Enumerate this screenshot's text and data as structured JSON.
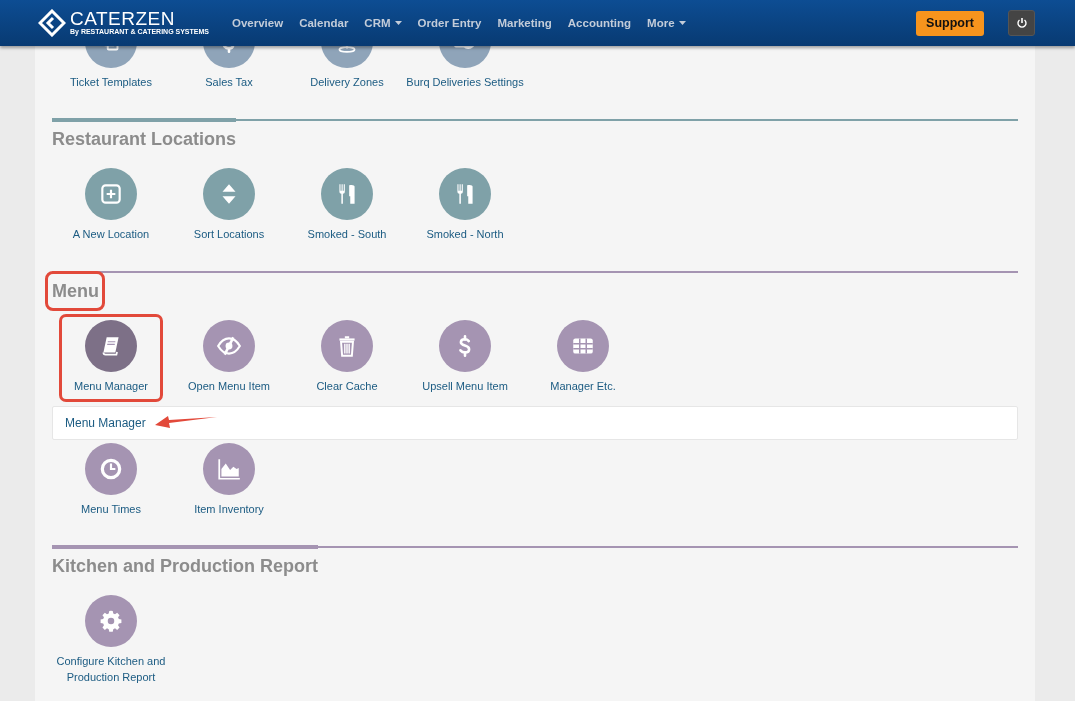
{
  "navbar": {
    "brand": "CATERZEN",
    "tagline": "By RESTAURANT & CATERING SYSTEMS",
    "items": [
      {
        "label": "Overview",
        "dropdown": false
      },
      {
        "label": "Calendar",
        "dropdown": false
      },
      {
        "label": "CRM",
        "dropdown": true
      },
      {
        "label": "Order Entry",
        "dropdown": false
      },
      {
        "label": "Marketing",
        "dropdown": false
      },
      {
        "label": "Accounting",
        "dropdown": false
      },
      {
        "label": "More",
        "dropdown": true
      }
    ],
    "support": "Support"
  },
  "sections": [
    {
      "color": "#8fa4b9",
      "rows": [
        [
          {
            "kind": "copy",
            "label": "Ticket Templates",
            "selected": false,
            "highlighted": false
          },
          {
            "kind": "dollar",
            "label": "Sales Tax",
            "selected": false,
            "highlighted": false
          },
          {
            "kind": "pin",
            "label": "Delivery Zones",
            "selected": false,
            "highlighted": false
          },
          {
            "kind": "scooter",
            "label": "Burq Deliveries Settings",
            "selected": false,
            "highlighted": false
          }
        ]
      ]
    },
    {
      "title": "Restaurant Locations",
      "color": "#7fa1a8",
      "accent": true,
      "highlighted": false,
      "rows": [
        [
          {
            "kind": "plus",
            "label": "A New Location",
            "selected": false,
            "highlighted": false
          },
          {
            "kind": "sort",
            "label": "Sort Locations",
            "selected": false,
            "highlighted": false
          },
          {
            "kind": "utensils",
            "label": "Smoked - South",
            "selected": false,
            "highlighted": false
          },
          {
            "kind": "utensils",
            "label": "Smoked - North",
            "selected": false,
            "highlighted": false
          }
        ]
      ]
    },
    {
      "title": "Menu",
      "color": "#a594b2",
      "accent": false,
      "highlighted": true,
      "submenu": {
        "label": "Menu Manager",
        "annotated": true
      },
      "rows": [
        [
          {
            "kind": "book",
            "label": "Menu Manager",
            "selected": true,
            "highlighted": true
          },
          {
            "kind": "eyeslash",
            "label": "Open Menu Item",
            "selected": false,
            "highlighted": false
          },
          {
            "kind": "trash",
            "label": "Clear Cache",
            "selected": false,
            "highlighted": false
          },
          {
            "kind": "dollar",
            "label": "Upsell Menu Item",
            "selected": false,
            "highlighted": false
          },
          {
            "kind": "table",
            "label": "Manager Etc.",
            "selected": false,
            "highlighted": false
          }
        ],
        [
          {
            "kind": "clock",
            "label": "Menu Times",
            "selected": false,
            "highlighted": false
          },
          {
            "kind": "chart",
            "label": "Item Inventory",
            "selected": false,
            "highlighted": false
          }
        ]
      ]
    },
    {
      "title": "Kitchen and Production Report",
      "color": "#a594b2",
      "accent": true,
      "highlighted": false,
      "rows": [
        [
          {
            "kind": "gear",
            "label": "Configure Kitchen and Production Report",
            "selected": false,
            "highlighted": false
          }
        ]
      ]
    }
  ]
}
